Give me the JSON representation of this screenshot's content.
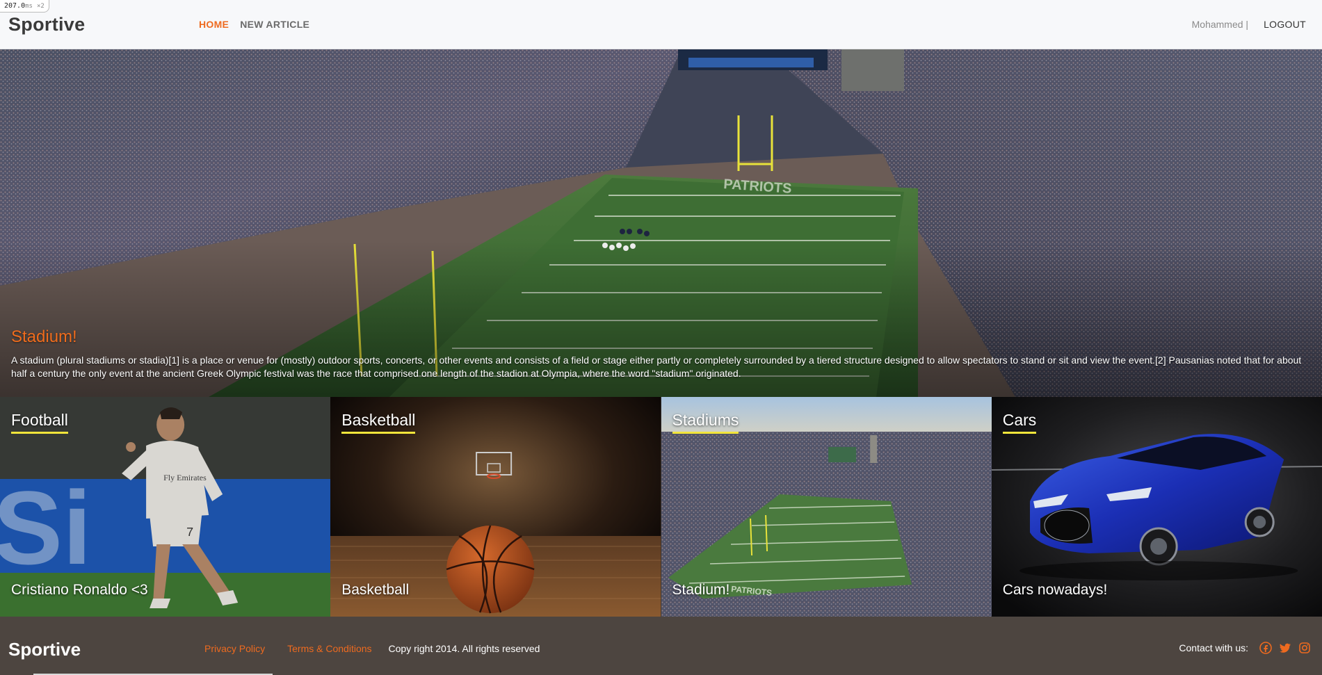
{
  "perf_badge": {
    "value": "207.0",
    "unit": "ms",
    "suffix": "×2"
  },
  "header": {
    "brand": "Sportive",
    "nav": [
      {
        "label": "HOME",
        "active": true
      },
      {
        "label": "NEW ARTICLE",
        "active": false
      }
    ],
    "username": "Mohammed |",
    "logout_label": "LOGOUT"
  },
  "hero": {
    "title": "Stadium!",
    "text": "A stadium (plural stadiums or stadia)[1] is a place or venue for (mostly) outdoor sports, concerts, or other events and consists of a field or stage either partly or completely surrounded by a tiered structure designed to allow spectators to stand or sit and view the event.[2] Pausanias noted that for about half a century the only event at the ancient Greek Olympic festival was the race that comprised one length of the stadion at Olympia, where the word \"stadium\" originated."
  },
  "tiles": [
    {
      "title": "Football",
      "caption": "Cristiano Ronaldo <3"
    },
    {
      "title": "Basketball",
      "caption": "Basketball"
    },
    {
      "title": "Stadiums",
      "caption": "Stadium!"
    },
    {
      "title": "Cars",
      "caption": "Cars nowadays!"
    }
  ],
  "footer": {
    "brand": "Sportive",
    "privacy_label": "Privacy Policy",
    "terms_label": "Terms & Conditions",
    "copyright": "Copy right 2014. All rights reserved",
    "contact_label": "Contact with us:",
    "social_icons": [
      "facebook-icon",
      "twitter-icon",
      "instagram-icon"
    ]
  },
  "colors": {
    "accent": "#ee6a1f",
    "tile_underline": "#f2e53b",
    "footer_bg": "#4d4540",
    "header_bg": "#f7f8fa"
  }
}
